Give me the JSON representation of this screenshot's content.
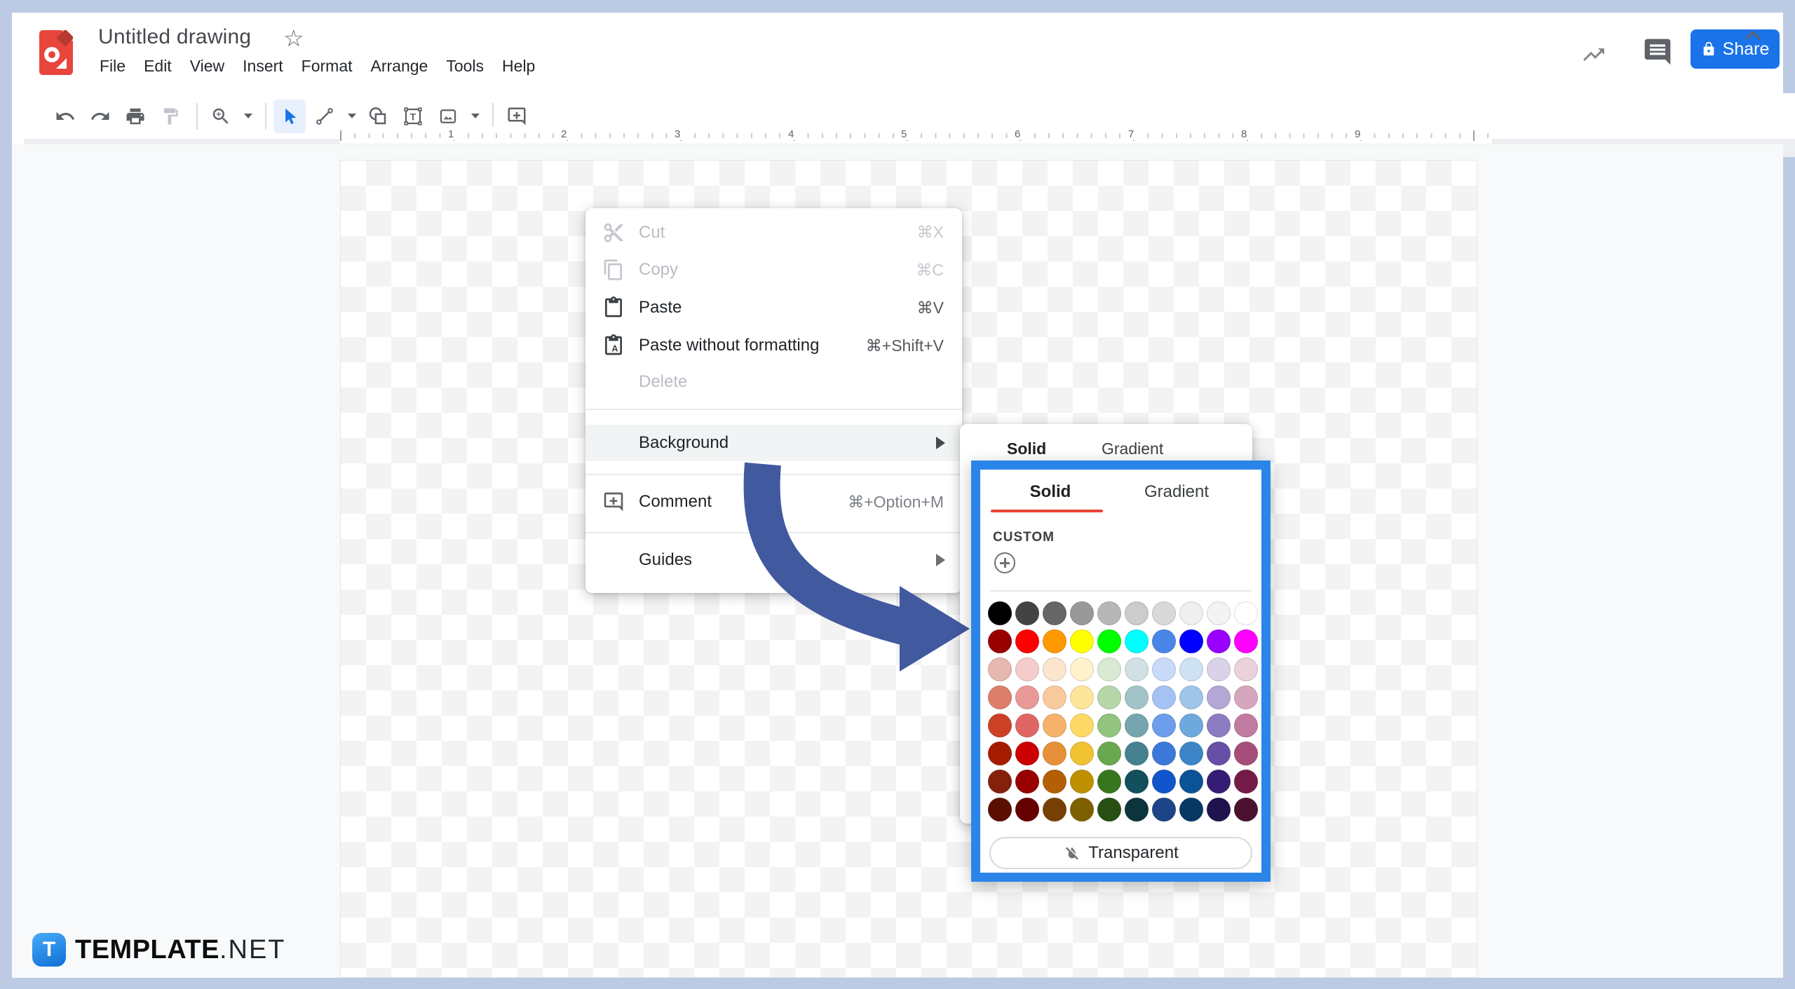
{
  "header": {
    "doc_title": "Untitled drawing",
    "menus": [
      "File",
      "Edit",
      "View",
      "Insert",
      "Format",
      "Arrange",
      "Tools",
      "Help"
    ],
    "share_label": "Share"
  },
  "toolbar": {
    "tools": [
      "undo",
      "redo",
      "print",
      "paint-format",
      "zoom",
      "select",
      "line",
      "shape",
      "text-box",
      "image",
      "insert-comment"
    ],
    "active_tool": "select"
  },
  "ruler": {
    "numbers": [
      "1",
      "2",
      "3",
      "4",
      "5",
      "6",
      "7",
      "8",
      "9"
    ]
  },
  "context_menu": {
    "items": [
      {
        "label": "Cut",
        "shortcut": "⌘X",
        "state": "disabled"
      },
      {
        "label": "Copy",
        "shortcut": "⌘C",
        "state": "disabled"
      },
      {
        "label": "Paste",
        "shortcut": "⌘V",
        "state": "enabled"
      },
      {
        "label": "Paste without formatting",
        "shortcut": "⌘+Shift+V",
        "state": "enabled"
      },
      {
        "label": "Delete",
        "shortcut": "",
        "state": "disabled"
      },
      {
        "label": "Background",
        "shortcut": "",
        "state": "highlighted",
        "submenu": true
      },
      {
        "label": "Comment",
        "shortcut": "⌘+Option+M",
        "state": "enabled"
      },
      {
        "label": "Guides",
        "shortcut": "",
        "state": "enabled",
        "submenu": true
      }
    ]
  },
  "background_submenu": {
    "tabs": [
      "Solid",
      "Gradient"
    ]
  },
  "color_picker": {
    "tabs": [
      "Solid",
      "Gradient"
    ],
    "active_tab": "Solid",
    "custom_label": "CUSTOM",
    "transparent_label": "Transparent",
    "swatch_rows": [
      [
        "#000000",
        "#434343",
        "#666666",
        "#999999",
        "#b7b7b7",
        "#cccccc",
        "#d9d9d9",
        "#efefef",
        "#f3f3f3",
        "#ffffff"
      ],
      [
        "#980000",
        "#ff0000",
        "#ff9900",
        "#ffff00",
        "#00ff00",
        "#00ffff",
        "#4a86e8",
        "#0000ff",
        "#9900ff",
        "#ff00ff"
      ],
      [
        "#e6b8af",
        "#f4cccc",
        "#fce5cd",
        "#fff2cc",
        "#d9ead3",
        "#d0e0e3",
        "#c9daf8",
        "#cfe2f3",
        "#d9d2e9",
        "#ead1dc"
      ],
      [
        "#dd7e6b",
        "#ea9999",
        "#f9cb9c",
        "#ffe599",
        "#b6d7a8",
        "#a2c4c9",
        "#a4c2f4",
        "#9fc5e8",
        "#b4a7d6",
        "#d5a6bd"
      ],
      [
        "#cc4125",
        "#e06666",
        "#f6b26b",
        "#ffd966",
        "#93c47d",
        "#76a5af",
        "#6d9eeb",
        "#6fa8dc",
        "#8e7cc3",
        "#c27ba0"
      ],
      [
        "#a61c00",
        "#cc0000",
        "#e69138",
        "#f1c232",
        "#6aa84f",
        "#45818e",
        "#3c78d8",
        "#3d85c6",
        "#674ea7",
        "#a64d79"
      ],
      [
        "#85200c",
        "#990000",
        "#b45f06",
        "#bf9000",
        "#38761d",
        "#134f5c",
        "#1155cc",
        "#0b5394",
        "#351c75",
        "#741b47"
      ],
      [
        "#5b0f00",
        "#660000",
        "#783f04",
        "#7f6000",
        "#274e13",
        "#0c343d",
        "#1c4587",
        "#073763",
        "#20124d",
        "#4c1130"
      ]
    ]
  },
  "watermark": {
    "logo_letter": "T",
    "brand_bold": "TEMPLATE",
    "brand_suffix": ".NET"
  },
  "colors": {
    "share_button": "#1a73e8",
    "highlight_border": "#2b85e8",
    "tab_underline": "#ea4335",
    "arrow": "#41599f",
    "frame": "#bccae4",
    "logo_red": "#e8453c",
    "select_highlight_bg": "#e8f0fe"
  }
}
